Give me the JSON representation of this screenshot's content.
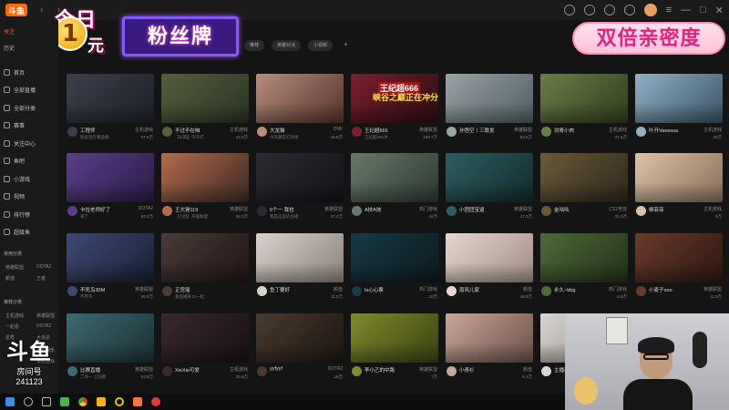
{
  "titlebar": {
    "app_logo": "斗鱼"
  },
  "promo": {
    "line1": "今日",
    "number": "1",
    "yuan": "元",
    "badge": "粉丝牌",
    "right": "双倍亲密度"
  },
  "sidebar": {
    "tab_follow": "关注",
    "tab_history": "历史",
    "items": [
      "首页",
      "全部直播",
      "全部分类",
      "赛事",
      "关注中心",
      "鱼吧",
      "小游戏",
      "视频",
      "排行榜",
      "超级鱼"
    ],
    "section_common": "常用分类",
    "common_sub": [
      "英雄联盟",
      "DOTA2",
      "颜值",
      "王者"
    ],
    "section_recommend": "推荐分类",
    "recommend_sub": [
      "主机游戏",
      "英雄联盟",
      "一起看",
      "DOTA2",
      "星秀",
      "大逃杀"
    ],
    "section_extra": "互动娱乐",
    "extra_sub": [
      "单机游戏"
    ]
  },
  "categories": [
    "推荐",
    "英雄对决",
    "小视频"
  ],
  "cards": [
    {
      "title": "工程师",
      "cat": "主机游戏",
      "sub": "别说话在看直播",
      "heat": "87.5万"
    },
    {
      "title": "不过不在咱",
      "cat": "主机游戏",
      "sub": "【长期】今天打",
      "heat": "24.3万"
    },
    {
      "title": "大龙猫",
      "cat": "DNF",
      "sub": "今天都在打的地",
      "heat": "49.8万"
    },
    {
      "title": "王纪超666",
      "cat": "英雄联盟",
      "sub": "王纪超666冲",
      "heat": "180.7万",
      "tag1": "王纪超666",
      "tag2": "峡谷之巅正在冲分"
    },
    {
      "title": "孙悟空丨三联发",
      "cat": "英雄联盟",
      "sub": "",
      "heat": "53.5万"
    },
    {
      "title": "洪哥小肉",
      "cat": "主机游戏",
      "sub": "",
      "heat": "27.5万"
    },
    {
      "title": "叶开Vanessa",
      "cat": "主机游戏",
      "sub": "",
      "heat": "20万"
    },
    {
      "title": "卡拉老师好了",
      "cat": "DOTA2",
      "sub": "来了",
      "heat": "83.4万"
    },
    {
      "title": "王大锤119",
      "cat": "英雄联盟",
      "sub": "【小团】英雄联盟",
      "heat": "69.3万"
    },
    {
      "title": "6个一 我也",
      "cat": "英雄联盟",
      "sub": "我是这里的主播",
      "heat": "37.4万"
    },
    {
      "title": "A技A技",
      "cat": "热门游戏",
      "sub": "",
      "heat": "46万"
    },
    {
      "title": "小团团宝逼",
      "cat": "英雄联盟",
      "sub": "",
      "heat": "17.3万"
    },
    {
      "title": "金咕咕",
      "cat": "CS2竞技",
      "sub": "",
      "heat": "20.3万"
    },
    {
      "title": "柳菲菲",
      "cat": "主机游戏",
      "sub": "",
      "heat": "8万"
    },
    {
      "title": "不死鸟30M",
      "cat": "英雄联盟",
      "sub": "不死鸟",
      "heat": "86.8万"
    },
    {
      "title": "正宫瑶",
      "cat": "",
      "sub": "看直播来10一起",
      "heat": ""
    },
    {
      "title": "鱼丁要好",
      "cat": "颜值",
      "sub": "",
      "heat": "11.5万"
    },
    {
      "title": "ts心心票",
      "cat": "热门游戏",
      "sub": "",
      "heat": "18万"
    },
    {
      "title": "南风儿家",
      "cat": "颜值",
      "sub": "",
      "heat": "49.8万"
    },
    {
      "title": "永久~bbg",
      "cat": "热门游戏",
      "sub": "",
      "heat": "8.8万"
    },
    {
      "title": "小麦子ooo",
      "cat": "英雄联盟",
      "sub": "",
      "heat": "11.9万"
    },
    {
      "title": "比赛直播",
      "cat": "英雄联盟",
      "sub": "二哥一 之前都",
      "heat": "53.8万"
    },
    {
      "title": "XieXie可爱",
      "cat": "主机游戏",
      "sub": "",
      "heat": "25.6万"
    },
    {
      "title": "yyfyyf",
      "cat": "DOTA2",
      "sub": "",
      "heat": "16万"
    },
    {
      "title": "李小乙的中路",
      "cat": "英雄联盟",
      "sub": "",
      "heat": "7万"
    },
    {
      "title": "小青衫",
      "cat": "颜值",
      "sub": "",
      "heat": "6.1万"
    },
    {
      "title": "主播小白",
      "cat": "颜值",
      "sub": "",
      "heat": "5.3万"
    }
  ],
  "watermark": {
    "logo": "斗鱼",
    "label": "房间号",
    "number": "241123"
  }
}
